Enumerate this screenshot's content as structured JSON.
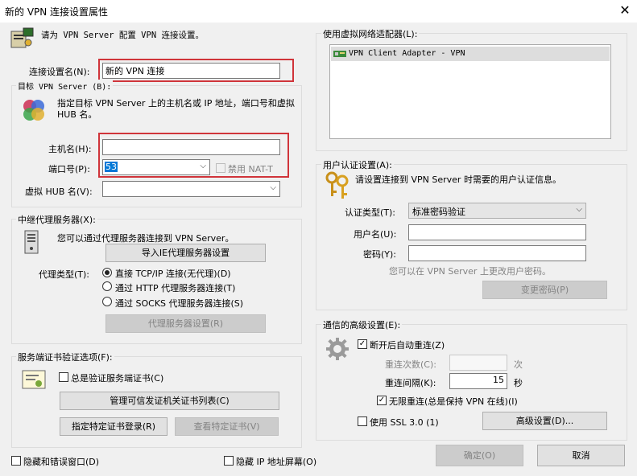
{
  "window": {
    "title": "新的 VPN 连接设置属性",
    "close_glyph": "✕"
  },
  "intro": {
    "text": "请为 VPN Server 配置 VPN 连接设置。"
  },
  "connection_name": {
    "label": "连接设置名(N):",
    "value": "新的 VPN 连接"
  },
  "target_server": {
    "group_title": "目标 VPN Server (B):",
    "description": "指定目标 VPN Server 上的主机名或 IP 地址，端口号和虚拟 HUB 名。",
    "hostname": {
      "label": "主机名(H):",
      "value": ""
    },
    "port": {
      "label": "端口号(P):",
      "value": "53"
    },
    "disable_nat_t": {
      "label": "禁用 NAT-T",
      "checked": false
    },
    "hub": {
      "label": "虚拟 HUB 名(V):",
      "value": ""
    }
  },
  "proxy": {
    "group_title": "中继代理服务器(X):",
    "description": "您可以通过代理服务器连接到 VPN Server。",
    "import_button": "导入IE代理服务器设置",
    "type_label": "代理类型(T):",
    "options": [
      {
        "label": "直接 TCP/IP 连接(无代理)(D)",
        "selected": true
      },
      {
        "label": "通过 HTTP 代理服务器连接(T)",
        "selected": false
      },
      {
        "label": "通过 SOCKS 代理服务器连接(S)",
        "selected": false
      }
    ],
    "settings_button": "代理服务器设置(R)"
  },
  "cert": {
    "group_title": "服务端证书验证选项(F):",
    "always_verify": {
      "label": "总是验证服务端证书(C)",
      "checked": false
    },
    "manage_button": "管理可信发证机关证书列表(C)",
    "specify_button": "指定特定证书登录(R)",
    "view_button": "查看特定证书(V)"
  },
  "adapter": {
    "group_title": "使用虚拟网络适配器(L):",
    "items": [
      "VPN Client Adapter - VPN"
    ]
  },
  "auth": {
    "group_title": "用户认证设置(A):",
    "description": "请设置连接到 VPN Server 时需要的用户认证信息。",
    "type_label": "认证类型(T):",
    "type_value": "标准密码验证",
    "username_label": "用户名(U):",
    "username_value": "",
    "password_label": "密码(Y):",
    "password_value": "",
    "hint": "您可以在 VPN Server 上更改用户密码。",
    "change_password_button": "变更密码(P)"
  },
  "advanced": {
    "group_title": "通信的高级设置(E):",
    "auto_reconnect": {
      "label": "断开后自动重连(Z)",
      "checked": true
    },
    "retry_count_label": "重连次数(C):",
    "retry_count_value": "",
    "retry_count_unit": "次",
    "retry_interval_label": "重连间隔(K):",
    "retry_interval_value": "15",
    "retry_interval_unit": "秒",
    "infinite": {
      "label": "无限重连(总是保持 VPN 在线)(I)",
      "checked": true
    },
    "ssl3": {
      "label": "使用 SSL 3.0 (1)",
      "checked": false
    },
    "advanced_button": "高级设置(D)..."
  },
  "footer": {
    "hide_status": {
      "label": "隐藏和错误窗口(D)",
      "checked": false
    },
    "hide_ip": {
      "label": "隐藏 IP 地址屏幕(O)",
      "checked": false
    },
    "ok_button": "确定(O)",
    "cancel_button": "取消"
  }
}
